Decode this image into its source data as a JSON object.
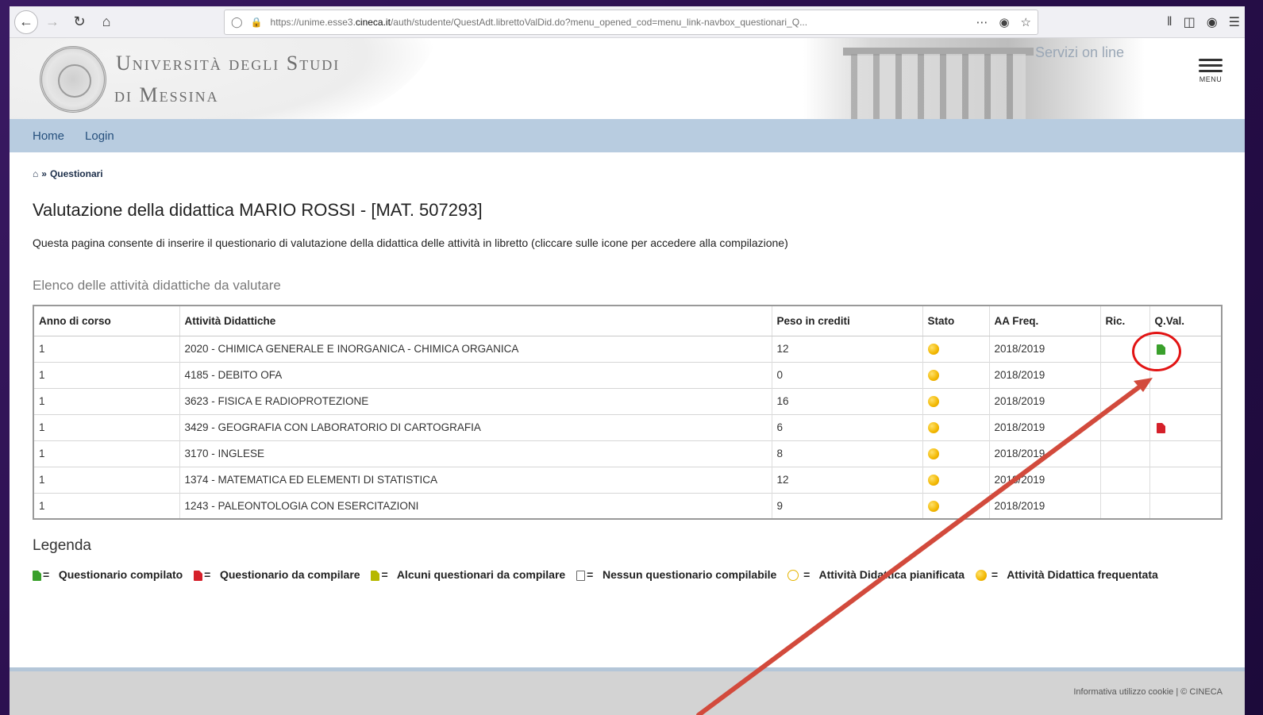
{
  "browser": {
    "url_prefix": "https://unime.esse3.",
    "url_domain": "cineca.it",
    "url_suffix": "/auth/studente/QuestAdt.librettoValDid.do?menu_opened_cod=menu_link-navbox_questionari_Q..."
  },
  "header": {
    "university_line1": "Università degli Studi",
    "university_line2": "di Messina",
    "servizi": "Servizi on line",
    "menu_label": "MENU"
  },
  "nav": {
    "home": "Home",
    "login": "Login"
  },
  "breadcrumb": {
    "current": "Questionari"
  },
  "page": {
    "title": "Valutazione della didattica MARIO ROSSI - [MAT. 507293]",
    "description": "Questa pagina consente di inserire il questionario di valutazione della didattica delle attività in libretto (cliccare sulle icone per accedere alla compilazione)",
    "section_title": "Elenco delle attività didattiche da valutare"
  },
  "table": {
    "headers": [
      "Anno di corso",
      "Attività Didattiche",
      "Peso in crediti",
      "Stato",
      "AA Freq.",
      "Ric.",
      "Q.Val."
    ],
    "rows": [
      {
        "anno": "1",
        "attivita": "2020 - CHIMICA GENERALE E INORGANICA - CHIMICA ORGANICA",
        "crediti": "12",
        "aa": "2018/2019",
        "qval": "green"
      },
      {
        "anno": "1",
        "attivita": "4185 - DEBITO OFA",
        "crediti": "0",
        "aa": "2018/2019",
        "qval": ""
      },
      {
        "anno": "1",
        "attivita": "3623 - FISICA E RADIOPROTEZIONE",
        "crediti": "16",
        "aa": "2018/2019",
        "qval": ""
      },
      {
        "anno": "1",
        "attivita": "3429 - GEOGRAFIA CON LABORATORIO DI CARTOGRAFIA",
        "crediti": "6",
        "aa": "2018/2019",
        "qval": "red"
      },
      {
        "anno": "1",
        "attivita": "3170 - INGLESE",
        "crediti": "8",
        "aa": "2018/2019",
        "qval": ""
      },
      {
        "anno": "1",
        "attivita": "1374 - MATEMATICA ED ELEMENTI DI STATISTICA",
        "crediti": "12",
        "aa": "2018/2019",
        "qval": ""
      },
      {
        "anno": "1",
        "attivita": "1243 - PALEONTOLOGIA CON ESERCITAZIONI",
        "crediti": "9",
        "aa": "2018/2019",
        "qval": ""
      }
    ]
  },
  "legend": {
    "title": "Legenda",
    "questionario_compilato": "Questionario compilato",
    "questionario_da_compilare": "Questionario da compilare",
    "alcuni_questionari": "Alcuni questionari da compilare",
    "nessun_questionario": "Nessun questionario compilabile",
    "pianificata": "Attività Didattica pianificata",
    "frequentata": "Attività Didattica frequentata",
    "equals": "="
  },
  "footer": {
    "text": "Informativa utilizzo cookie | © CINECA"
  },
  "colors": {
    "annotation": "#e21414",
    "arrow": "#d24a3c",
    "nav_bg": "#b8cce0"
  }
}
